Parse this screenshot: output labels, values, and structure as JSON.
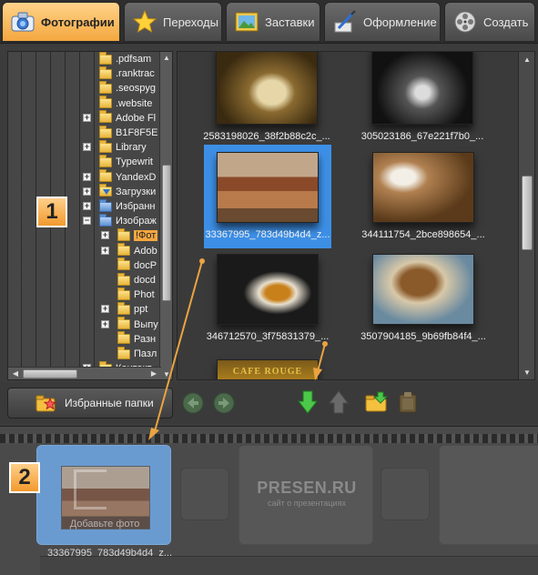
{
  "tabs": [
    {
      "label": "Фотографии",
      "icon": "camera-icon",
      "active": true
    },
    {
      "label": "Переходы",
      "icon": "star-icon",
      "active": false
    },
    {
      "label": "Заставки",
      "icon": "picture-frame-icon",
      "active": false
    },
    {
      "label": "Оформление",
      "icon": "pen-brush-icon",
      "active": false
    },
    {
      "label": "Создать",
      "icon": "film-reel-icon",
      "active": false
    }
  ],
  "tree": {
    "items": [
      {
        "label": ".pdfsam",
        "expander": ""
      },
      {
        "label": ".ranktrac",
        "expander": ""
      },
      {
        "label": ".seospyg",
        "expander": ""
      },
      {
        "label": ".website",
        "expander": ""
      },
      {
        "label": "Adobe Fl",
        "expander": "+"
      },
      {
        "label": "B1F8F5E",
        "expander": ""
      },
      {
        "label": "Library",
        "expander": "+"
      },
      {
        "label": "Typewrit",
        "expander": ""
      },
      {
        "label": "YandexD",
        "expander": "+"
      },
      {
        "label": "Загрузки",
        "expander": "+"
      },
      {
        "label": "Избранн",
        "expander": "+"
      },
      {
        "label": "Изображ",
        "expander": "−"
      },
      {
        "label": "!Фот",
        "expander": "+"
      },
      {
        "label": "Adob",
        "expander": "+"
      },
      {
        "label": "docP",
        "expander": ""
      },
      {
        "label": "docd",
        "expander": ""
      },
      {
        "label": "Phot",
        "expander": ""
      },
      {
        "label": "ppt",
        "expander": "+"
      },
      {
        "label": "Выпу",
        "expander": "+"
      },
      {
        "label": "Разн",
        "expander": ""
      },
      {
        "label": "Пазл",
        "expander": ""
      },
      {
        "label": "Контакт",
        "expander": "+"
      }
    ],
    "badge": "1"
  },
  "photos": [
    {
      "caption": "2583198026_38f2b88c2c_...",
      "selected": false
    },
    {
      "caption": "305023186_67e221f7b0_...",
      "selected": false
    },
    {
      "caption": "33367995_783d49b4d4_z...",
      "selected": true
    },
    {
      "caption": "344111754_2bce898654_...",
      "selected": false
    },
    {
      "caption": "346712570_3f75831379_...",
      "selected": false
    },
    {
      "caption": "3507904185_9b69fb84f4_...",
      "selected": false
    },
    {
      "caption": "CAFE ROUGE",
      "selected": false
    }
  ],
  "toolbar": {
    "favorites_label": "Избранные папки"
  },
  "strip": {
    "badge": "2",
    "slot_caption": "33367995_783d49b4d4_z...",
    "overlay_text": "Добавьте фото",
    "watermark_title": "PRESEN.RU",
    "watermark_subtitle": "сайт о презентациях"
  },
  "colors": {
    "active_tab": "#f4a73f",
    "selection": "#3d8fe6",
    "arrow_annotation": "#e9a441",
    "badge": "#f29a2e"
  }
}
